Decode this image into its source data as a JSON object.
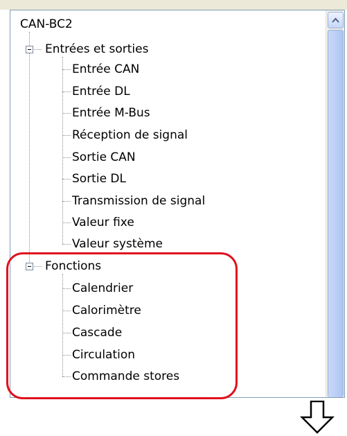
{
  "tree": {
    "root": "CAN-BC2",
    "groups": [
      {
        "label": "Entrées et sorties",
        "items": [
          "Entrée CAN",
          "Entrée DL",
          "Entrée M-Bus",
          "Réception de signal",
          "Sortie CAN",
          "Sortie DL",
          "Transmission de signal",
          "Valeur fixe",
          "Valeur système"
        ]
      },
      {
        "label": "Fonctions",
        "items": [
          "Calendrier",
          "Calorimètre",
          "Cascade",
          "Circulation",
          "Commande stores"
        ]
      }
    ]
  },
  "icons": {
    "expand_toggle": "minus-box-icon",
    "scroll_up": "chevron-up-icon",
    "annotation_arrow": "down-arrow-icon"
  },
  "colors": {
    "highlight": "#e0101e",
    "scrollbar_thumb": "#bccff5"
  }
}
